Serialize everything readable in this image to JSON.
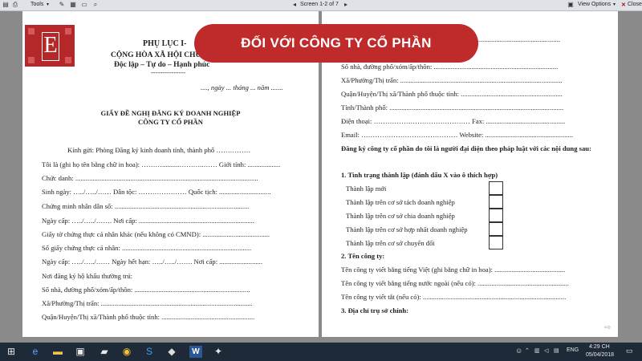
{
  "toolbar": {
    "tools_label": "Tools",
    "screen_label": "Screen 1-2 of 7",
    "view_options_label": "View Options",
    "close_label": "Close"
  },
  "banner": {
    "text": "ĐỐI VỚI CÔNG TY CỔ PHẦN"
  },
  "logo": {
    "letter": "E"
  },
  "left_page": {
    "header_title": "PHỤ LỤC I-",
    "republic": "CỘNG HÒA XÃ HỘI CHỦ NGH",
    "motto": "Độc lập – Tự do – Hạnh phúc",
    "rule": "---------------",
    "date_line": "...., ngày ... tháng ... năm .......",
    "form_title": "GIẤY ĐỀ NGHỊ ĐĂNG KÝ DOANH NGHIỆP",
    "form_subtitle": "CÔNG TY CỔ PHẦN",
    "recipient": "Kính gửi: Phòng Đăng ký kinh doanh tỉnh, thành phố ……………",
    "lines": [
      "Tôi là (ghi họ tên bằng chữ in hoa): ………..........………..…… Giới tính: ...................",
      "Chức danh: ..........................................................................................................",
      "Sinh ngày: …../…../…… Dân tộc: ………………… Quốc tịch: ..............................",
      "Chứng minh nhân dân số: ..............................................................................",
      "Ngày cấp: …../…../……. Nơi cấp: ...................................................................",
      "Giấy tờ chứng thực cá nhân khác (nếu không có CMND): .......................................",
      "Số giấy chứng thực cá nhân: ...........................................................................",
      "Ngày cấp: …../…../…… Ngày hết hạn: …../…../……. Nơi cấp: .........................",
      "Nơi đăng ký hộ khẩu thường trú:",
      "Số nhà, đường phố/xóm/ấp/thôn: ...................................................................",
      "Xã/Phường/Thị trấn: ........................................................................................",
      "Quận/Huyện/Thị xã/Thành phố thuộc tỉnh: ......................................................"
    ]
  },
  "right_page": {
    "top_line": "...............................................................................................................................",
    "lines_a": [
      "Số nhà, đường phố/xóm/ấp/thôn: ........................................................................",
      "Xã/Phường/Thị trấn: ..............................................................................................",
      "Quận/Huyện/Thị xã/Thành phố thuộc tỉnh: ...........................................................",
      "Tỉnh/Thành phố: .....................................................................................................",
      "Điện thoại: …………………………………… Fax: ..............................................",
      "Email: …………………………………… Website: ..................................................."
    ],
    "rep_heading": "Đăng ký công ty cổ phần do tôi là người đại diện theo pháp luật với các nội dung sau:",
    "section1": "1. Tình trạng thành lập (đánh dấu X vào ô thích hợp)",
    "status_items": [
      "Thành lập mới",
      "Thành lập trên cơ sở tách doanh nghiệp",
      "Thành lập trên cơ sở chia doanh nghiệp",
      "Thành lập trên cơ sở hợp nhất doanh nghiệp",
      "Thành lập trên cơ sở chuyển đổi"
    ],
    "section2": "2. Tên công ty:",
    "names": [
      "Tên công ty viết bằng tiếng Việt (ghi bằng chữ in hoa): .........................................",
      "Tên công ty viết bằng tiếng nước ngoài (nếu có): .....................................................",
      "Tên công ty viết tắt (nếu có): ..................................................................................."
    ],
    "section3": "3. Địa chỉ trụ sở chính:"
  },
  "taskbar": {
    "language": "ENG",
    "time": "4:29 CH",
    "date": "05/04/2018"
  },
  "colors": {
    "banner": "#bf2a2a",
    "logo": "#b5282a",
    "taskbar": "#1e2a38"
  }
}
